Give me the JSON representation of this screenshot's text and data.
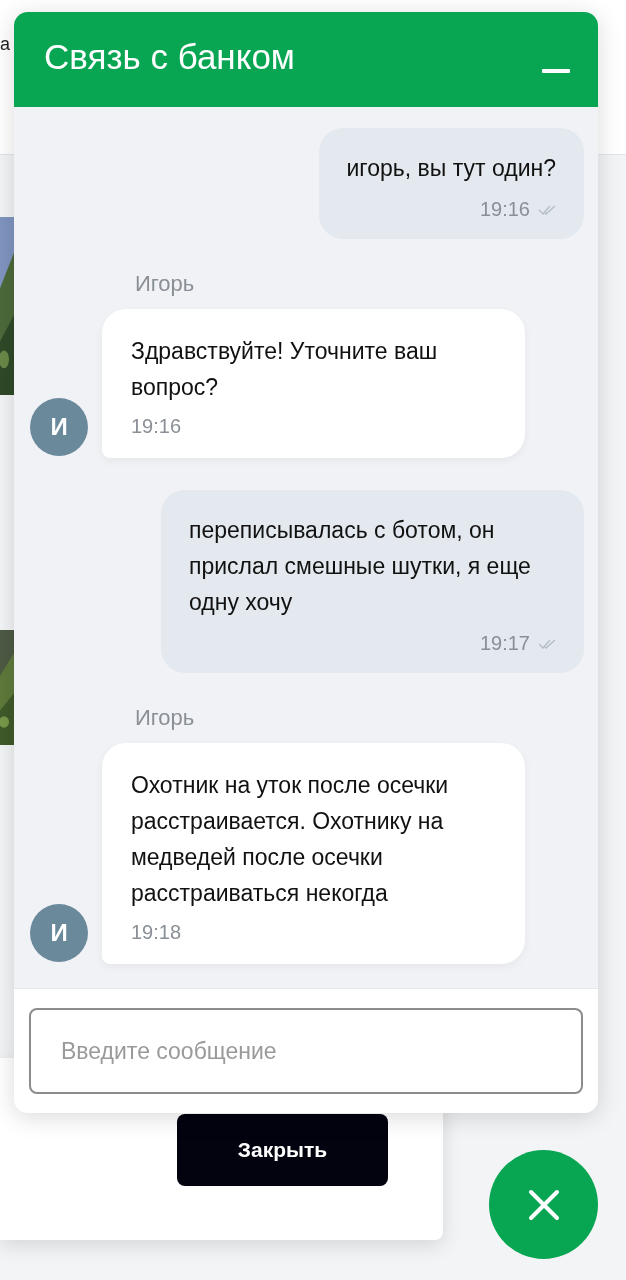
{
  "background_page": {
    "header_text": "а",
    "close_button": "Закрыть"
  },
  "chat": {
    "title": "Связь с банком",
    "messages": [
      {
        "kind": "outgoing",
        "text": "игорь, вы тут один?",
        "time": "19:16",
        "read": true
      },
      {
        "kind": "incoming",
        "sender": "Игорь",
        "avatar": "И",
        "text": "Здравствуйте! Уточните ваш вопрос?",
        "time": "19:16"
      },
      {
        "kind": "outgoing",
        "text": "переписывалась с ботом, он прислал смешные шутки, я еще одну хочу",
        "time": "19:17",
        "read": true
      },
      {
        "kind": "incoming",
        "sender": "Игорь",
        "avatar": "И",
        "text": "Охотник на уток после осечки расстраивается. Охотнику на медведей после осечки расстраиваться некогда",
        "time": "19:18"
      }
    ],
    "input": {
      "placeholder": "Введите сообщение"
    }
  }
}
